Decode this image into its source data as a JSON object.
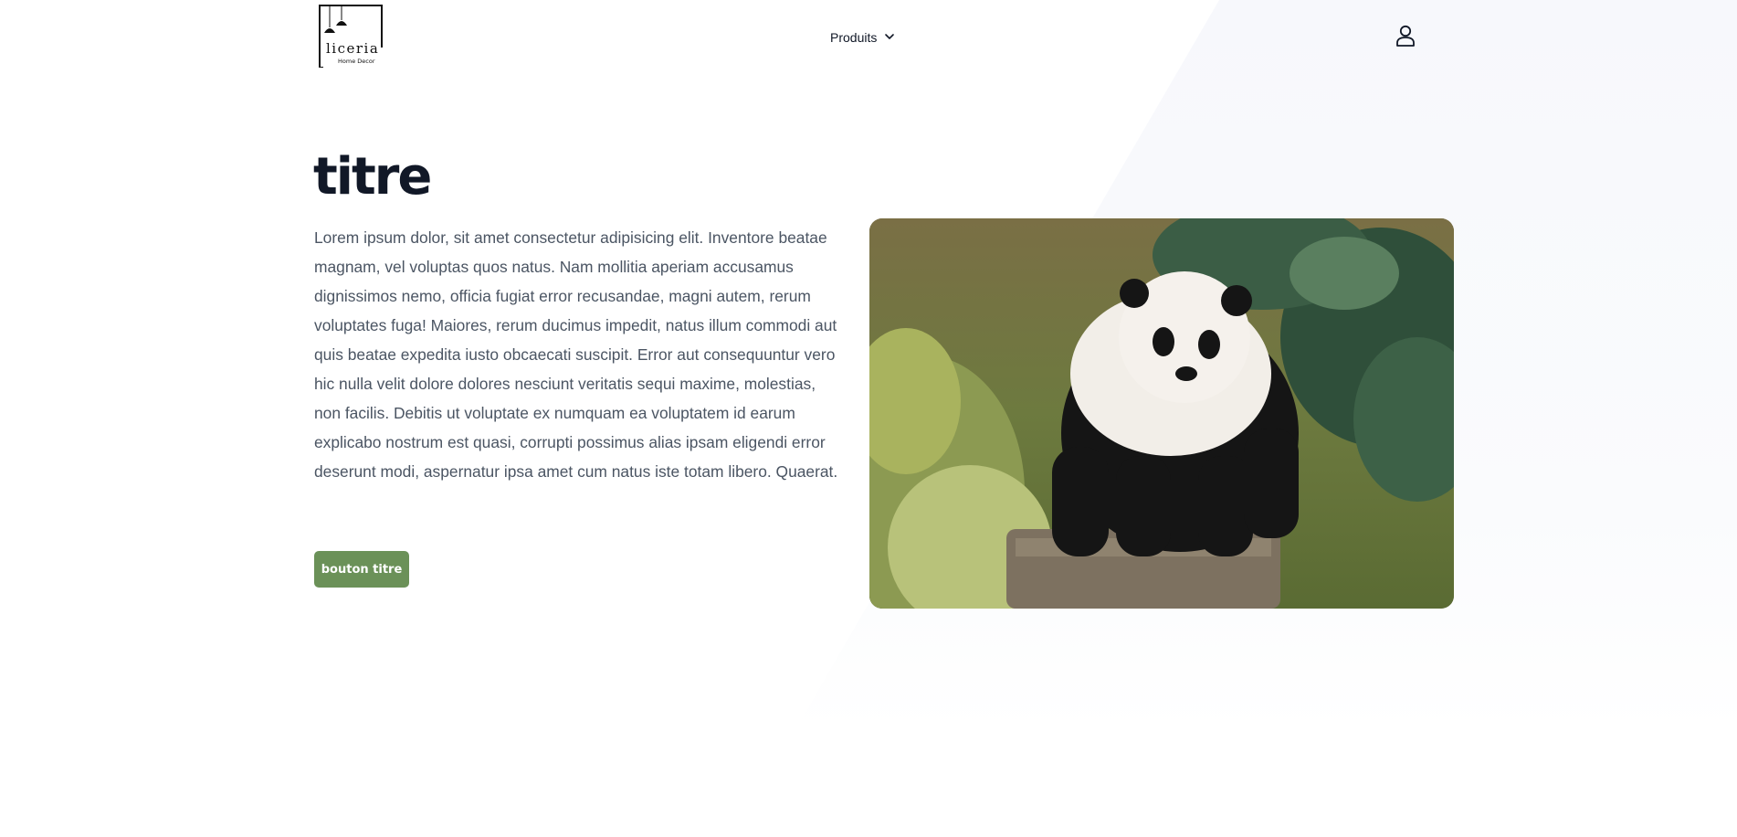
{
  "header": {
    "logo": {
      "wordmark": "liceria",
      "tagline": "Home Decor"
    },
    "nav": {
      "products_label": "Produits"
    },
    "user_icon": "user-icon"
  },
  "hero": {
    "title": "titre",
    "paragraph": "Lorem ipsum dolor, sit amet consectetur adipisicing elit. Inventore beatae magnam, vel voluptas quos natus. Nam mollitia aperiam accusamus dignissimos nemo, officia fugiat error recusandae, magni autem, rerum voluptates fuga! Maiores, rerum ducimus impedit, natus illum commodi aut quis beatae expedita iusto obcaecati suscipit. Error aut consequuntur vero hic nulla velit dolore dolores nesciunt veritatis sequi maxime, molestias, non facilis. Debitis ut voluptate ex numquam ea voluptatem id earum explicabo nostrum est quasi, corrupti possimus alias ipsam eligendi error deserunt modi, aspernatur ipsa amet cum natus iste totam libero. Quaerat.",
    "button_label": "bouton titre",
    "image": "panda-photo"
  },
  "colors": {
    "button": "#6b9158",
    "title": "#111827",
    "body_text": "#4b5563",
    "background_shape": "#f8f9fc"
  }
}
